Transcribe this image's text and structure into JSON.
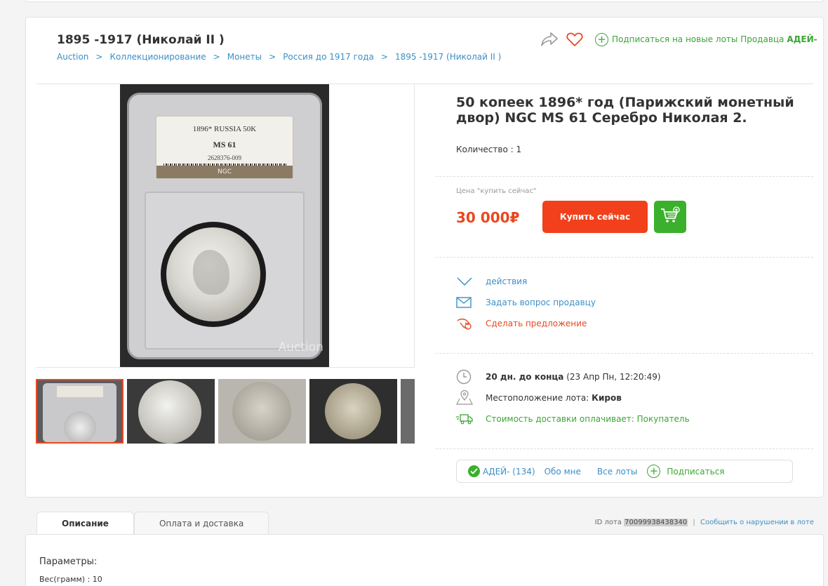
{
  "category": {
    "title": "1895 -1917 (Николай II )",
    "breadcrumbs": [
      "Auction",
      "Коллекционирование",
      "Монеты",
      "Россия до 1917 года",
      "1895 -1917 (Николай II )"
    ],
    "separator": ">"
  },
  "top_actions": {
    "subscribe_text": "Подписаться на новые лоты Продавца",
    "seller_name": "АДЕЙ-"
  },
  "photo": {
    "slab_line1": "1896* RUSSIA 50K",
    "slab_grade": "MS 61",
    "slab_cert": "2628376-009",
    "slab_brand": "NGC",
    "watermark": "Auction"
  },
  "lot": {
    "title": "50 копеек 1896* год (Парижский монетный двор) NGC MS 61 Серебро Николая 2.",
    "quantity_label": "Количество : 1",
    "price_label": "Цена \"купить сейчас\"",
    "price": "30 000₽",
    "buy_label": "Купить сейчас"
  },
  "actions": {
    "menu": "действия",
    "ask": "Задать вопрос продавцу",
    "offer": "Сделать предложение"
  },
  "info": {
    "time_left": "20 дн. до конца",
    "time_end": "(23 Апр Пн, 12:20:49)",
    "location_label": "Местоположение лота:",
    "location": "Киров",
    "delivery": "Стоимость доставки оплачивает: Покупатель"
  },
  "seller": {
    "name_rating": "АДЕЙ- (134)",
    "about": "Обо мне",
    "all_lots": "Все лоты",
    "subscribe": "Подписаться"
  },
  "tabs": [
    "Описание",
    "Оплата и доставка"
  ],
  "lot_id": {
    "label": "ID лота",
    "value": "70099938438340",
    "divider": "|",
    "report": "Сообщить о нарушении в лоте"
  },
  "params": {
    "heading": "Параметры:",
    "weight": "Вес(грамм) : 10"
  },
  "colors": {
    "accent_red": "#f1401b",
    "accent_green": "#3bb02c",
    "link_blue": "#3b8fc7"
  }
}
